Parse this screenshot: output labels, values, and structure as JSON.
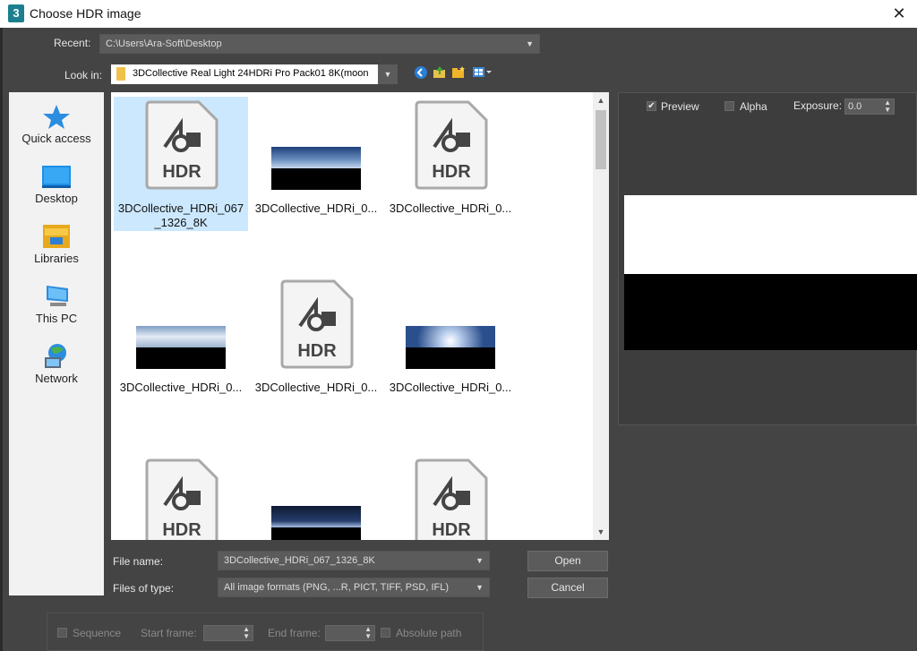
{
  "window": {
    "title": "Choose HDR image",
    "app_icon": "3"
  },
  "recent": {
    "label": "Recent:",
    "value": "C:\\Users\\Ara-Soft\\Desktop"
  },
  "look_in": {
    "label": "Look in:",
    "value": "3DCollective Real Light 24HDRi Pro Pack01 8K(moon"
  },
  "toolbar_icons": [
    "back-icon",
    "up-folder-icon",
    "new-folder-icon",
    "view-menu-icon"
  ],
  "places": [
    {
      "label": "Quick access",
      "icon": "star-icon"
    },
    {
      "label": "Desktop",
      "icon": "desktop-icon"
    },
    {
      "label": "Libraries",
      "icon": "libraries-icon"
    },
    {
      "label": "This PC",
      "icon": "computer-icon"
    },
    {
      "label": "Network",
      "icon": "network-icon"
    }
  ],
  "files": [
    {
      "name": "3DCollective_HDRi_067_1326_8K",
      "kind": "hdr",
      "selected": true
    },
    {
      "name": "3DCollective_HDRi_0...",
      "kind": "pano"
    },
    {
      "name": "3DCollective_HDRi_0...",
      "kind": "hdr"
    },
    {
      "name": "3DCollective_HDRi_0...",
      "kind": "pano"
    },
    {
      "name": "3DCollective_HDRi_0...",
      "kind": "hdr"
    },
    {
      "name": "3DCollective_HDRi_0...",
      "kind": "pano"
    },
    {
      "name": "",
      "kind": "hdr"
    },
    {
      "name": "",
      "kind": "pano"
    },
    {
      "name": "",
      "kind": "hdr"
    }
  ],
  "hdr_icon_label": "HDR",
  "file_name": {
    "label": "File name:",
    "value": "3DCollective_HDRi_067_1326_8K"
  },
  "file_type": {
    "label": "Files of type:",
    "value": "All image formats (PNG, ...R, PICT, TIFF, PSD, IFL)"
  },
  "buttons": {
    "open": "Open",
    "cancel": "Cancel"
  },
  "preview": {
    "preview_label": "Preview",
    "preview_checked": true,
    "alpha_label": "Alpha",
    "alpha_checked": false,
    "exposure_label": "Exposure:",
    "exposure_value": "0.0"
  },
  "sequence": {
    "sequence_label": "Sequence",
    "start_frame_label": "Start frame:",
    "end_frame_label": "End frame:",
    "absolute_path_label": "Absolute path"
  },
  "colors": {
    "dialog_bg": "#444444",
    "selection": "#cce8ff",
    "accent_icon": "#1c7f8f"
  }
}
